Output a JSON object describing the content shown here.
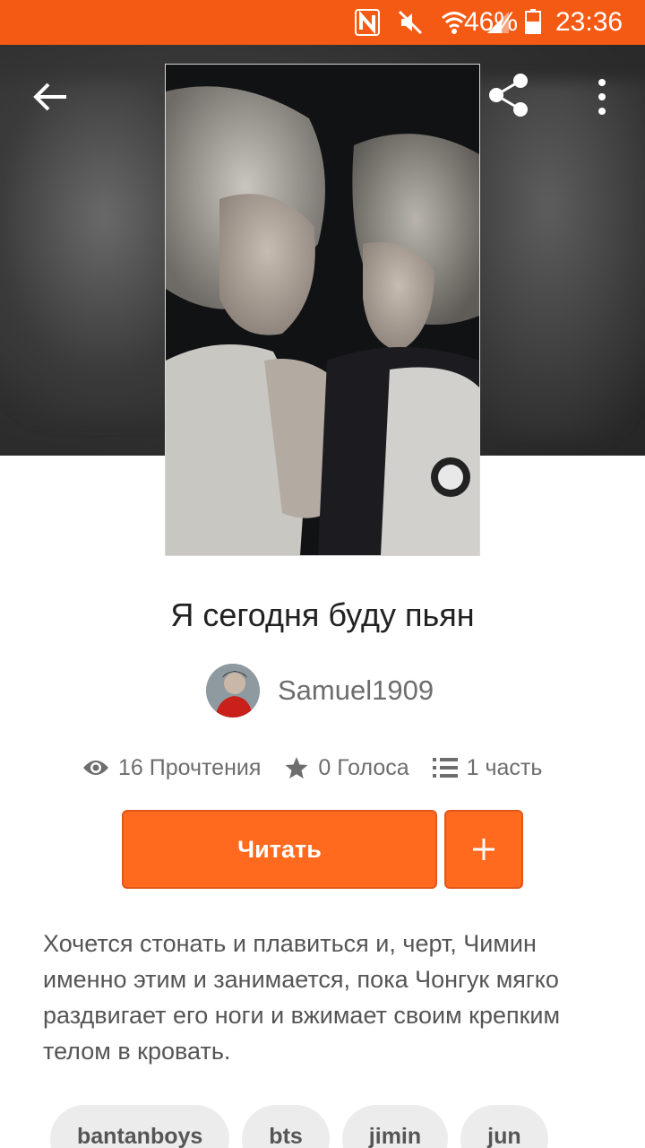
{
  "status_bar": {
    "battery": "46%",
    "time": "23:36",
    "icons": [
      "nfc-icon",
      "mute-icon",
      "wifi-icon",
      "signal-icon",
      "battery-icon"
    ]
  },
  "colors": {
    "accent": "#ff6a1f",
    "status_bar": "#f55a14"
  },
  "story": {
    "title": "Я сегодня буду пьян",
    "author": "Samuel1909",
    "stats": {
      "reads": "16 Прочтения",
      "votes": "0 Голоса",
      "parts": "1 часть"
    },
    "read_label": "Читать",
    "description": "Хочется стонать и плавиться и, черт, Чимин именно этим и занимается, пока Чонгук мягко раздвигает его ноги и вжимает своим крепким телом в кровать.",
    "tags": [
      "bantanboys",
      "bts",
      "jimin",
      "jun"
    ]
  }
}
